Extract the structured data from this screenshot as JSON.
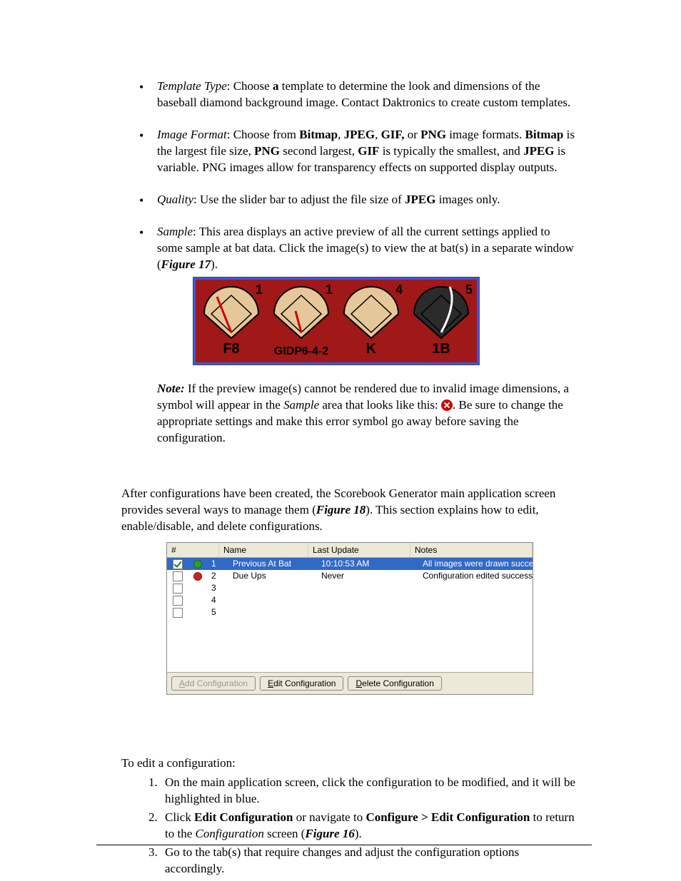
{
  "bullets": {
    "template": {
      "title": "Template Type",
      "body_1": ": Choose ",
      "a": "a",
      "body_2": " template to determine the look and dimensions of the baseball diamond background image. Contact Daktronics to create custom templates."
    },
    "image": {
      "title": "Image Format",
      "p1": ": Choose from ",
      "f1": "Bitmap",
      "p2": ", ",
      "f2": "JPEG",
      "p3": ", ",
      "f3": "GIF,",
      "p4": " or ",
      "f4": "PNG",
      "p5": " image formats. ",
      "b_large": "Bitmap",
      "p6": " is the largest file size, ",
      "b_png": "PNG",
      "p7": " second largest, ",
      "b_gif": "GIF",
      "p8": " is typically the smallest, and ",
      "b_jpeg": "JPEG",
      "p9": " is variable. PNG images allow for transparency effects on supported display outputs."
    },
    "quality": {
      "title": "Quality",
      "p1": ": Use the slider bar to adjust the file size of ",
      "jpeg": "JPEG",
      "p2": " images only."
    },
    "sample": {
      "title": "Sample",
      "body": ": This area displays an active preview of all the current settings applied to some sample at bat data. Click the image(s) to view the at bat(s) in a separate window (",
      "figref": "Figure 17",
      "close": ")."
    }
  },
  "fig_cells": [
    {
      "num": "1",
      "label": "F8"
    },
    {
      "num": "1",
      "label": "GIDP6-4-2"
    },
    {
      "num": "4",
      "label": "K"
    },
    {
      "num": "5",
      "label": "1B"
    }
  ],
  "note": {
    "lead": "Note:",
    "p1": " If the preview image(s) cannot be rendered due to invalid image dimensions, a symbol will appear in the ",
    "sample": "Sample",
    "p2": " area that looks like this: ",
    "p3": ". Be sure to change the appropriate settings and make this error symbol go away before saving the configuration."
  },
  "para2": {
    "p1": "After configurations have been created, the Scorebook Generator main application screen provides several ways to manage them (",
    "figref": "Figure 18",
    "p2": "). This section explains how to edit, enable/disable, and delete configurations."
  },
  "dlg": {
    "headers": {
      "num": "#",
      "name": "Name",
      "last_update": "Last Update",
      "notes": "Notes"
    },
    "rows": [
      {
        "checked": true,
        "led": "g",
        "num": "1",
        "name": "Previous At Bat",
        "last_update": "10:10:53 AM",
        "notes": "All images were drawn successfully.",
        "selected": true
      },
      {
        "checked": false,
        "led": "r",
        "num": "2",
        "name": "Due Ups",
        "last_update": "Never",
        "notes": "Configuration edited successfully.",
        "selected": false
      },
      {
        "checked": false,
        "led": "",
        "num": "3",
        "name": "",
        "last_update": "",
        "notes": "",
        "selected": false
      },
      {
        "checked": false,
        "led": "",
        "num": "4",
        "name": "",
        "last_update": "",
        "notes": "",
        "selected": false
      },
      {
        "checked": false,
        "led": "",
        "num": "5",
        "name": "",
        "last_update": "",
        "notes": "",
        "selected": false
      }
    ],
    "buttons": {
      "add": {
        "ul": "A",
        "rest": "dd Configuration",
        "disabled": true
      },
      "edit": {
        "ul": "E",
        "rest": "dit Configuration",
        "disabled": false
      },
      "delete": {
        "ul": "D",
        "rest": "elete Configuration",
        "disabled": false
      }
    }
  },
  "edit_heading": "To edit a configuration:",
  "steps": {
    "s1": "On the main application screen, click the configuration to be modified, and it will be highlighted in blue.",
    "s2a": "Click ",
    "s2b": "Edit Configuration",
    "s2c": " or navigate to ",
    "s2d": "Configure > Edit Configuration",
    "s2e": " to return to the ",
    "s2f": "Configuration",
    "s2g": " screen (",
    "s2h": "Figure 16",
    "s2i": ").",
    "s3": "Go to the tab(s) that require changes and adjust the configuration options accordingly."
  }
}
